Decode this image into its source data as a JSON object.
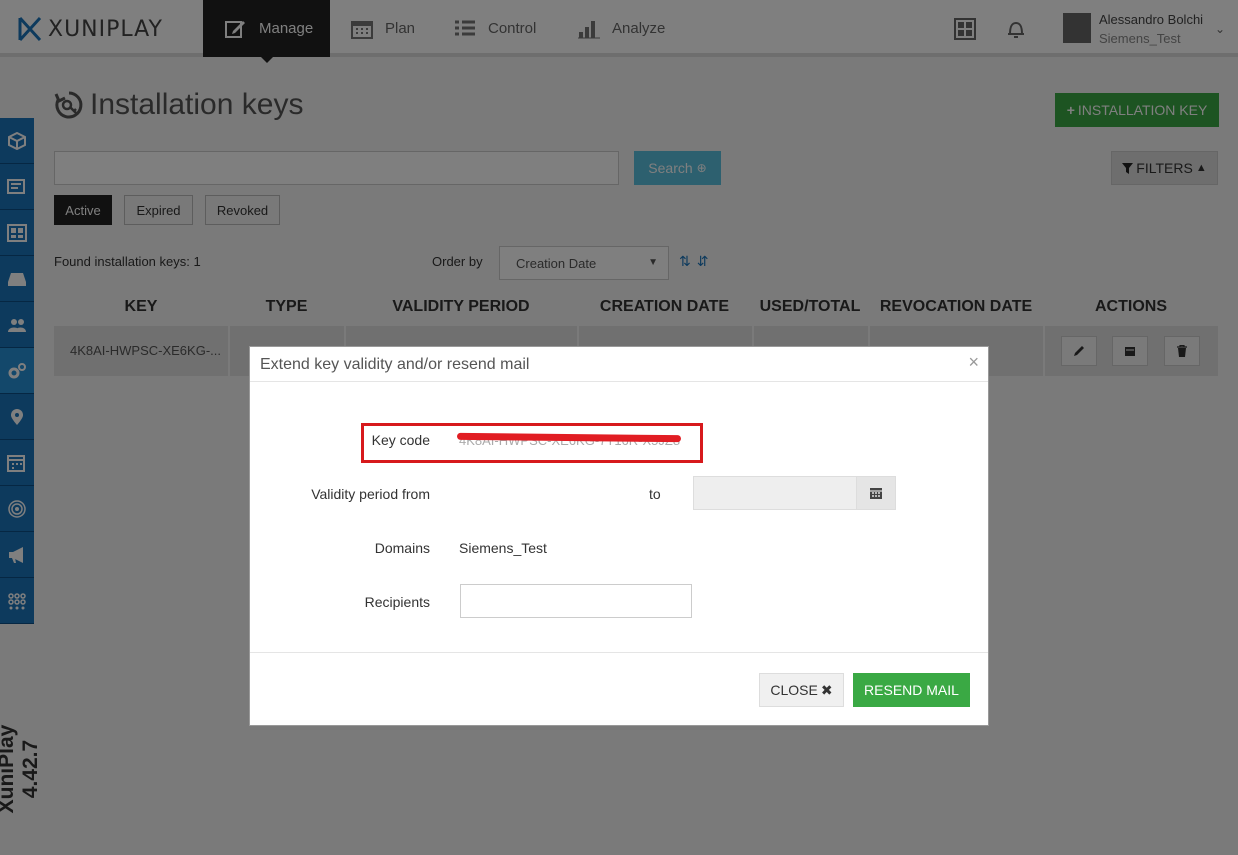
{
  "app": {
    "name": "XUNIPLAY",
    "version": "XuniPlay 4.42.7"
  },
  "nav": {
    "items": [
      {
        "label": "Manage",
        "icon": "edit-icon"
      },
      {
        "label": "Plan",
        "icon": "calendar-icon"
      },
      {
        "label": "Control",
        "icon": "list-icon"
      },
      {
        "label": "Analyze",
        "icon": "bar-chart-icon"
      }
    ]
  },
  "user": {
    "name": "Alessandro Bolchi",
    "org": "Siemens_Test"
  },
  "page": {
    "title": "Installation keys",
    "add_button": "INSTALLATION KEY",
    "search_button": "Search",
    "filters_button": "FILTERS",
    "tabs": [
      "Active",
      "Expired",
      "Revoked"
    ],
    "found_text": "Found installation keys: 1",
    "order_by_label": "Order by",
    "order_by_value": "Creation Date"
  },
  "table": {
    "headers": [
      "KEY",
      "TYPE",
      "VALIDITY PERIOD",
      "CREATION DATE",
      "USED/TOTAL",
      "REVOCATION DATE",
      "ACTIONS"
    ],
    "rows": [
      {
        "key": "4K8AI-HWPSC-XE6KG-..."
      }
    ]
  },
  "modal": {
    "title": "Extend key validity and/or resend mail",
    "close_x": "×",
    "key_code_label": "Key code",
    "key_code_value": "4K8AI-HWPSC-XE6KG-7T16R-X5JZ8",
    "validity_label": "Validity period from",
    "to_label": "to",
    "domains_label": "Domains",
    "domains_value": "Siemens_Test",
    "recipients_label": "Recipients",
    "close_button": "CLOSE",
    "resend_button": "RESEND MAIL"
  },
  "colors": {
    "accent_green": "#3aa944",
    "sidebar_blue": "#1b75bb",
    "highlight_red": "#d7191c"
  }
}
